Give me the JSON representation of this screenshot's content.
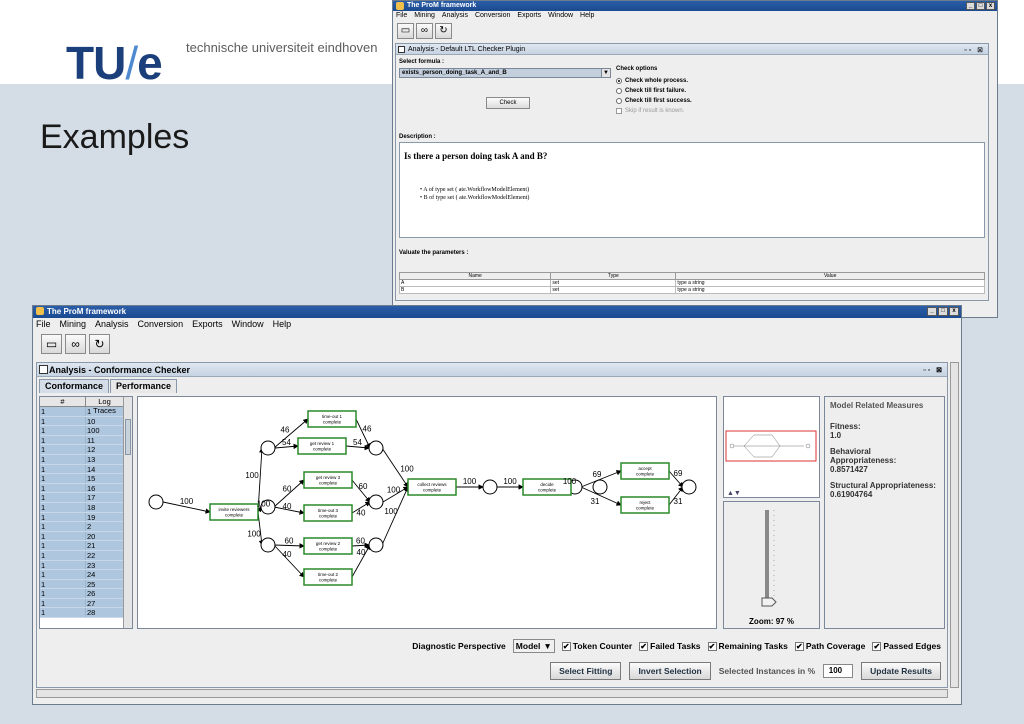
{
  "slide": {
    "logo_main": "TU",
    "logo_slash": "/",
    "logo_e": "e",
    "university": "technische universiteit eindhoven",
    "title": "Examples"
  },
  "back_window": {
    "title": "The ProM framework",
    "menu": [
      "File",
      "Mining",
      "Analysis",
      "Conversion",
      "Exports",
      "Window",
      "Help"
    ],
    "toolbar_icons": [
      "folder-icon",
      "binoculars-icon",
      "refresh-icon"
    ],
    "inner_title": "Analysis - Default LTL Checker Plugin",
    "select_formula_label": "Select formula :",
    "formula_value": "exists_person_doing_task_A_and_B",
    "check_label": "Check",
    "check_options_label": "Check options",
    "options": [
      {
        "label": "Check whole process.",
        "selected": true,
        "enabled": true
      },
      {
        "label": "Check till first failure.",
        "selected": false,
        "enabled": true
      },
      {
        "label": "Check till first success.",
        "selected": false,
        "enabled": true
      },
      {
        "label": "Skip if result is known.",
        "selected": false,
        "enabled": false
      }
    ],
    "description_label": "Description :",
    "question": "Is there a person doing task A and B?",
    "bullet_a": "• A of type set ( ate.WorkflowModelElement)",
    "bullet_b": "• B of type set ( ate.WorkflowModelElement)",
    "valuate_label": "Valuate the parameters :",
    "param_columns": [
      "Name",
      "Type",
      "Value"
    ],
    "params": [
      {
        "name": "A",
        "type": "set",
        "value": "type a string"
      },
      {
        "name": "B",
        "type": "set",
        "value": "type a string"
      }
    ]
  },
  "front_window": {
    "title": "The ProM framework",
    "menu": [
      "File",
      "Mining",
      "Analysis",
      "Conversion",
      "Exports",
      "Window",
      "Help"
    ],
    "inner_title": "Analysis - Conformance Checker",
    "tabs": [
      "Conformance",
      "Performance"
    ],
    "trace_columns": [
      "#",
      "Log Traces"
    ],
    "traces": [
      [
        "1",
        "1"
      ],
      [
        "1",
        "10"
      ],
      [
        "1",
        "100"
      ],
      [
        "1",
        "11"
      ],
      [
        "1",
        "12"
      ],
      [
        "1",
        "13"
      ],
      [
        "1",
        "14"
      ],
      [
        "1",
        "15"
      ],
      [
        "1",
        "16"
      ],
      [
        "1",
        "17"
      ],
      [
        "1",
        "18"
      ],
      [
        "1",
        "19"
      ],
      [
        "1",
        "2"
      ],
      [
        "1",
        "20"
      ],
      [
        "1",
        "21"
      ],
      [
        "1",
        "22"
      ],
      [
        "1",
        "23"
      ],
      [
        "1",
        "24"
      ],
      [
        "1",
        "25"
      ],
      [
        "1",
        "26"
      ],
      [
        "1",
        "27"
      ],
      [
        "1",
        "28"
      ]
    ],
    "model": {
      "tasks": [
        {
          "id": "invite",
          "l1": "invite reviewers",
          "l2": "complete"
        },
        {
          "id": "to1",
          "l1": "time-out 1",
          "l2": "complete"
        },
        {
          "id": "gr1",
          "l1": "get review 1",
          "l2": "complete"
        },
        {
          "id": "gr3",
          "l1": "get review 3",
          "l2": "complete"
        },
        {
          "id": "to3",
          "l1": "time-out 3",
          "l2": "complete"
        },
        {
          "id": "gr2",
          "l1": "get review 2",
          "l2": "complete"
        },
        {
          "id": "to2",
          "l1": "time-out 2",
          "l2": "complete"
        },
        {
          "id": "collect",
          "l1": "collect reviews",
          "l2": "complete"
        },
        {
          "id": "decide",
          "l1": "decide",
          "l2": "complete"
        },
        {
          "id": "accept",
          "l1": "accept",
          "l2": "complete"
        },
        {
          "id": "reject",
          "l1": "reject",
          "l2": "complete"
        }
      ],
      "edge_labels": {
        "start_invite": "100",
        "invite_p1": "100",
        "invite_p3": "100",
        "invite_p2": "100",
        "p1_to1": "46",
        "p1_gr1": "54",
        "to1_q1": "46",
        "gr1_q1": "54",
        "q1_collect": "100",
        "p3_gr3": "60",
        "p3_to3": "40",
        "gr3_q3": "60",
        "to3_q3": "40",
        "q3_collect": "100",
        "p2_gr2": "60",
        "p2_to2": "40",
        "gr2_q2": "60",
        "to2_q2": "40",
        "q2_collect": "100",
        "collect_p": "100",
        "p_decide": "100",
        "decide_p": "100",
        "p_accept": "69",
        "p_reject": "31",
        "accept_end": "69",
        "reject_end": "31"
      }
    },
    "zoom": "Zoom: 97 %",
    "measures_title": "Model Related Measures",
    "fitness_label": "Fitness:",
    "fitness_value": "1.0",
    "behavioral_label": "Behavioral Appropriateness:",
    "behavioral_value": "0.8571427",
    "structural_label": "Structural Appropriateness:",
    "structural_value": "0.61904764",
    "diagnostic_label": "Diagnostic Perspective",
    "perspective_value": "Model",
    "checkboxes": [
      "Token Counter",
      "Failed Tasks",
      "Remaining Tasks",
      "Path Coverage",
      "Passed Edges"
    ],
    "select_fitting": "Select Fitting",
    "invert_selection": "Invert Selection",
    "selected_instances_label": "Selected Instances in %",
    "selected_instances_value": "100",
    "update_results": "Update Results"
  }
}
